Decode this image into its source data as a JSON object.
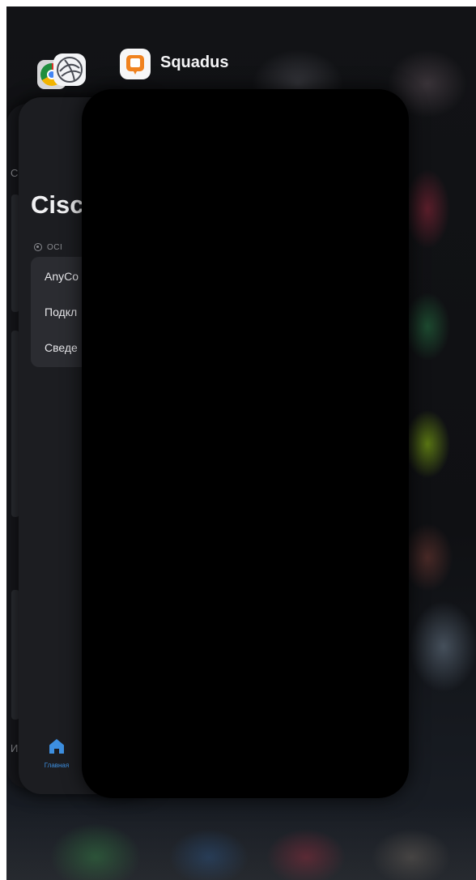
{
  "app_switcher": {
    "front_app": {
      "name": "Squadus",
      "icon": "squadus-app-icon"
    },
    "cisco_card": {
      "title": "Cisc",
      "section_label": "осі",
      "rows": [
        "AnyCo",
        "Подкл",
        "Сведе"
      ],
      "tab_label": "Главная",
      "tab_icon": "home-icon",
      "accent_color": "#3d8fe0"
    },
    "back_card": {
      "letter_top": "С",
      "letter_bottom": "И"
    },
    "background_icons": [
      "chrome-app-icon",
      "cisco-anyconnect-app-icon"
    ]
  }
}
